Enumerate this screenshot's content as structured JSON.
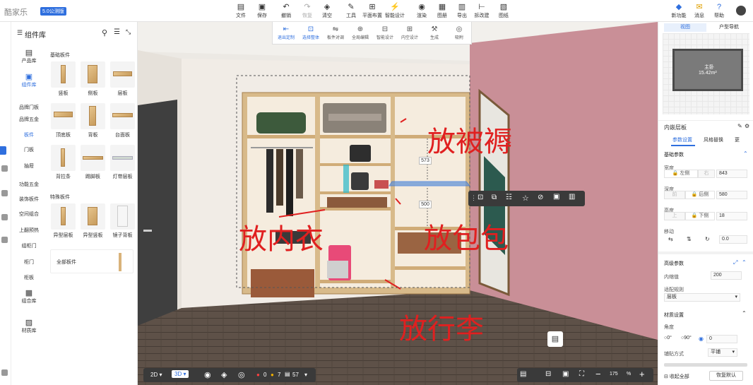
{
  "app": {
    "logo": "酷家乐",
    "version": "5.0公测版"
  },
  "toolbar": {
    "items": [
      {
        "label": "文件",
        "icon": "file-icon",
        "glyph": "▤"
      },
      {
        "label": "保存",
        "icon": "save-icon",
        "glyph": "▣"
      },
      {
        "label": "撤销",
        "icon": "undo-icon",
        "glyph": "↶"
      },
      {
        "label": "恢复",
        "icon": "redo-icon",
        "glyph": "↷"
      },
      {
        "label": "清空",
        "icon": "clear-icon",
        "glyph": "◈"
      },
      {
        "label": "工具",
        "icon": "tools-icon",
        "glyph": "✎"
      },
      {
        "label": "平面布置",
        "icon": "floorplan-icon",
        "glyph": "⊞"
      },
      {
        "label": "智能设计",
        "icon": "smart-design-icon",
        "glyph": "⚡"
      },
      {
        "label": "渲染",
        "icon": "render-icon",
        "glyph": "◉"
      },
      {
        "label": "图册",
        "icon": "album-icon",
        "glyph": "▦"
      },
      {
        "label": "导出",
        "icon": "export-icon",
        "glyph": "▥"
      },
      {
        "label": "拆改建",
        "icon": "remodel-icon",
        "glyph": "⊢"
      },
      {
        "label": "图纸",
        "icon": "drawing-icon",
        "glyph": "▧"
      }
    ],
    "right": [
      {
        "label": "新功能",
        "icon": "new-feature-icon",
        "glyph": "◆"
      },
      {
        "label": "消息",
        "icon": "message-icon",
        "glyph": "✉"
      },
      {
        "label": "帮助",
        "icon": "help-icon",
        "glyph": "?"
      }
    ]
  },
  "library": {
    "title": "组件库",
    "categories": [
      {
        "label": "产品库",
        "glyph": "▤"
      },
      {
        "label": "组件库",
        "glyph": "▣",
        "active": true
      },
      {
        "label": "品牌门板"
      },
      {
        "label": "品牌五金"
      },
      {
        "label": "板件",
        "active_text": true
      },
      {
        "label": "门板"
      },
      {
        "label": "抽屉"
      },
      {
        "label": "功能五金"
      },
      {
        "label": "装饰板件"
      },
      {
        "label": "空间组合"
      },
      {
        "label": "上翻预热"
      },
      {
        "label": "组柜门"
      },
      {
        "label": "柜门"
      },
      {
        "label": "柜板"
      },
      {
        "label": "组合库",
        "glyph": "▦"
      },
      {
        "label": "材质库",
        "glyph": "▨"
      }
    ],
    "basic_section": "基础板件",
    "basic_tiles": [
      "竖板",
      "侧板",
      "层板",
      "顶底板",
      "背板",
      "台面板",
      "背拉条",
      "踢脚板",
      "灯带层板"
    ],
    "special_section": "特殊板件",
    "special_tiles": [
      "异型层板",
      "异型竖板",
      "镜子背板"
    ],
    "all_label": "全部板件"
  },
  "viewport": {
    "subtoolbar": [
      "退出定制",
      "选择整体",
      "板件对调",
      "全局编辑",
      "智能设计",
      "内空设计",
      "生成",
      "吸附"
    ],
    "dimensions": [
      "573",
      "500"
    ],
    "annotations": [
      "放被褥",
      "放内衣",
      "放包包",
      "放行李"
    ],
    "bottombar": {
      "view2d": "2D",
      "view3d": "3D",
      "errors": "0",
      "warnings": "7",
      "items": "57",
      "zoom": "175",
      "zoom_unit": "%"
    }
  },
  "properties": {
    "minimap_tabs": [
      "视图",
      "户型导航"
    ],
    "room_name": "主卧",
    "room_area": "15.42m²",
    "panel_title": "内嵌层板",
    "tabs": [
      "参数设置",
      "风格替换",
      "更"
    ],
    "basic_section": "基础参数",
    "width_label": "宽度",
    "width_left": "左侧",
    "width_right": "右",
    "width_value": "843",
    "depth_label": "深度",
    "depth_front": "前",
    "depth_back": "后侧",
    "depth_value": "580",
    "height_label": "高度",
    "height_top": "上",
    "height_bottom": "下侧",
    "height_value": "18",
    "move_label": "移动",
    "move_value": "0.0",
    "advanced_section": "高级参数",
    "inset_label": "内缩值",
    "inset_value": "200",
    "rule_label": "适配规则",
    "rule_value": "层板",
    "material_section": "材质设置",
    "angle_label": "角度",
    "angle_options": [
      "0°",
      "90°",
      "0"
    ],
    "paving_label": "铺贴方式",
    "paving_value": "平铺",
    "collapse_all": "收起全部",
    "restore_default": "恢复默认"
  }
}
